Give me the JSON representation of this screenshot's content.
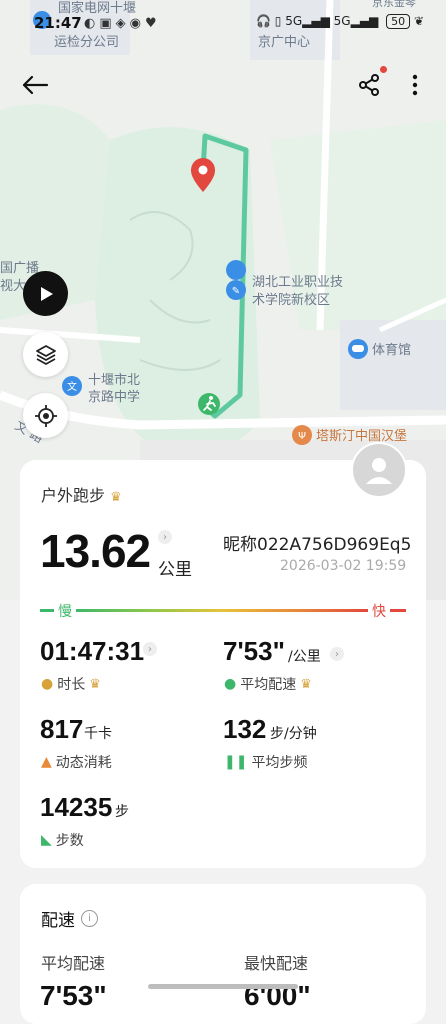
{
  "status_bar": {
    "time": "21:47",
    "battery": "50"
  },
  "map": {
    "labels": {
      "top_left": [
        "国家电网十堰",
        "运检分公司"
      ],
      "top_right": "京广中心",
      "far_top_right": "京东金琴",
      "left_edge": [
        "国广播",
        "视大"
      ],
      "school": [
        "湖北工业职业技",
        "术学院新校区"
      ],
      "stadium": "体育馆",
      "middle_school": [
        "十堰市北",
        "京路中学"
      ],
      "restaurant": "塔斯汀中国汉堡",
      "road": "文 路"
    },
    "route_color": "#5ec9a0"
  },
  "summary": {
    "activity": "户外跑步",
    "distance": "13.62",
    "distance_unit": "公里",
    "nickname": "昵称022A756D969Eq5",
    "datetime": "2026-03-02 19:59",
    "slow_label": "慢",
    "fast_label": "快"
  },
  "stats": {
    "duration": {
      "value": "01:47:31",
      "label": "时长"
    },
    "pace": {
      "value": "7'53\"",
      "unit": "/公里",
      "label": "平均配速"
    },
    "calories": {
      "value": "817",
      "unit": "千卡",
      "label": "动态消耗"
    },
    "cadence": {
      "value": "132",
      "unit": "步/分钟",
      "label": "平均步频"
    },
    "steps": {
      "value": "14235",
      "unit": "步",
      "label": "步数"
    }
  },
  "pace_card": {
    "title": "配速",
    "avg_label": "平均配速",
    "max_label": "最快配速",
    "avg_value": "7'53\"",
    "max_value": "6'00\""
  },
  "colors": {
    "accent_green": "#3db86a",
    "accent_red": "#e2483d",
    "medal_gold": "#d6a23a"
  }
}
